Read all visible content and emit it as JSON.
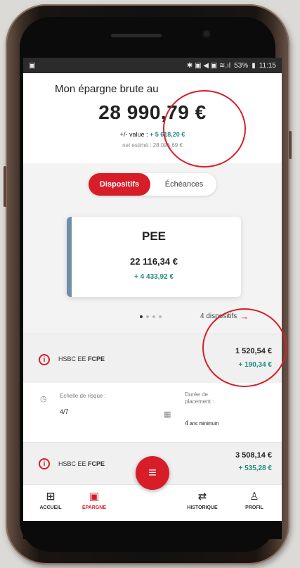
{
  "statusbar": {
    "left_icon": "image-icon",
    "right_text": "53%",
    "time": "11:15",
    "icons_text": "✱ ▣ ◀ ▣ ≋.ıl"
  },
  "header": {
    "label": "Mon épargne brute au",
    "amount": "28 990,79 €",
    "value_prefix": "+/- value : ",
    "value": "+ 5 618,20 €",
    "estimate_prefix": "net estimé : ",
    "estimate": "28 096,69 €"
  },
  "tabs": {
    "active": "Dispositifs",
    "inactive": "Échéances"
  },
  "card": {
    "title": "PEE",
    "amount": "22 116,34 €",
    "gain": "+ 4 433,92 €"
  },
  "carousel": {
    "link": "4 dispositifs"
  },
  "funds": [
    {
      "name": "HSBC EE ",
      "name_bold": "FCPE",
      "amount": "1 520,54 €",
      "gain": "+ 190,34 €"
    },
    {
      "name": "HSBC EE ",
      "name_bold": "FCPE",
      "amount": "3 508,14 €",
      "gain": "+ 535,28 €"
    }
  ],
  "details": {
    "risk_label": "Echelle de risque :",
    "risk_value": "4/7",
    "duration_label_1": "Durée de",
    "duration_label_2": "placement :",
    "duration_value_num": "4",
    "duration_value_text": " ans minimum"
  },
  "nav": {
    "home": "ACCUEIL",
    "savings": "EPARGNE",
    "history": "HISTORIQUE",
    "profile": "PROFIL"
  },
  "colors": {
    "brand_red": "#d71e28",
    "gain_green": "#1f8c80",
    "card_bar": "#6f8fa8"
  }
}
